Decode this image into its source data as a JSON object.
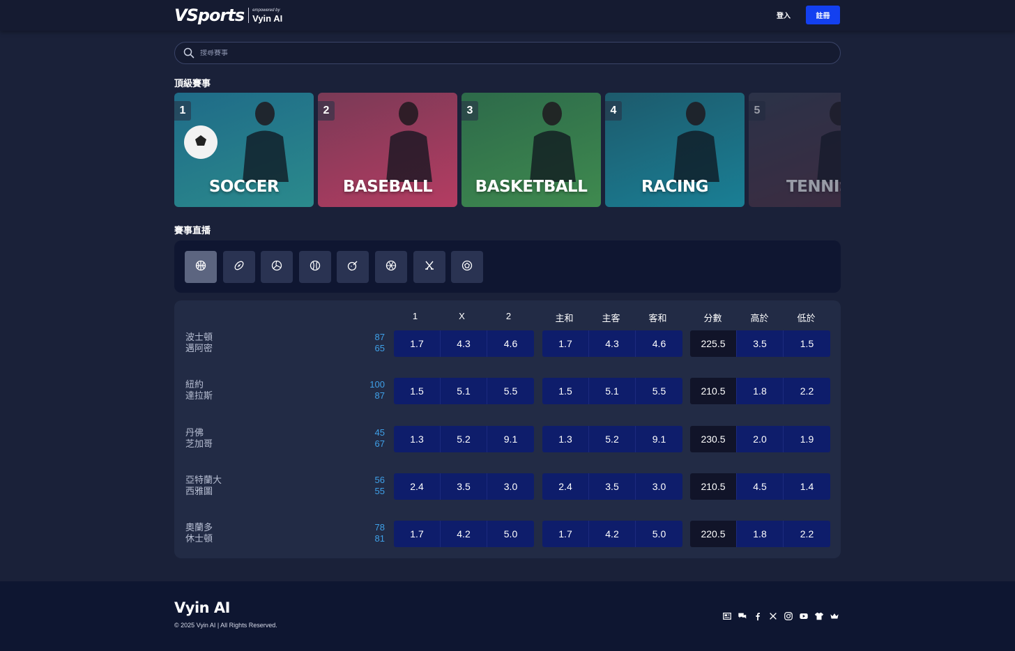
{
  "header": {
    "logo_main": "VSports",
    "logo_small": "empowered by",
    "logo_brand": "Vyin AI",
    "login_label": "登入",
    "register_label": "註冊"
  },
  "search": {
    "placeholder": "搜尋賽事"
  },
  "top_events": {
    "title": "頂級賽事",
    "cards": [
      {
        "rank": "1",
        "label": "SOCCER",
        "colors": [
          "#1f6b88",
          "#2b8a8c"
        ]
      },
      {
        "rank": "2",
        "label": "BASEBALL",
        "colors": [
          "#7a3a56",
          "#b43c62"
        ]
      },
      {
        "rank": "3",
        "label": "BASKETBALL",
        "colors": [
          "#2d6a4a",
          "#3f8a4f"
        ]
      },
      {
        "rank": "4",
        "label": "RACING",
        "colors": [
          "#1d5a6c",
          "#1a7f95"
        ]
      },
      {
        "rank": "5",
        "label": "TENNIS",
        "colors": [
          "#3a4155",
          "#5b3447"
        ]
      }
    ]
  },
  "live": {
    "title": "賽事直播",
    "sports": [
      "basketball-icon",
      "football-icon",
      "volleyball-icon",
      "baseball-icon",
      "golf-icon",
      "soccer-icon",
      "hockey-icon",
      "rugby-icon"
    ],
    "selected_index": 0
  },
  "odds_table": {
    "headers": [
      "1",
      "X",
      "2",
      "主和",
      "主客",
      "客和",
      "分數",
      "高於",
      "低於"
    ],
    "rows": [
      {
        "home": "波士頓",
        "away": "邁阿密",
        "home_score": "87",
        "away_score": "65",
        "g1": [
          "1.7",
          "4.3",
          "4.6"
        ],
        "g2": [
          "1.7",
          "4.3",
          "4.6"
        ],
        "total": "225.5",
        "over": "3.5",
        "under": "1.5"
      },
      {
        "home": "紐約",
        "away": "達拉斯",
        "home_score": "100",
        "away_score": "87",
        "g1": [
          "1.5",
          "5.1",
          "5.5"
        ],
        "g2": [
          "1.5",
          "5.1",
          "5.5"
        ],
        "total": "210.5",
        "over": "1.8",
        "under": "2.2"
      },
      {
        "home": "丹佛",
        "away": "芝加哥",
        "home_score": "45",
        "away_score": "67",
        "g1": [
          "1.3",
          "5.2",
          "9.1"
        ],
        "g2": [
          "1.3",
          "5.2",
          "9.1"
        ],
        "total": "230.5",
        "over": "2.0",
        "under": "1.9"
      },
      {
        "home": "亞特蘭大",
        "away": "西雅圖",
        "home_score": "56",
        "away_score": "55",
        "g1": [
          "2.4",
          "3.5",
          "3.0"
        ],
        "g2": [
          "2.4",
          "3.5",
          "3.0"
        ],
        "total": "210.5",
        "over": "4.5",
        "under": "1.4"
      },
      {
        "home": "奧蘭多",
        "away": "休士頓",
        "home_score": "78",
        "away_score": "81",
        "g1": [
          "1.7",
          "4.2",
          "5.0"
        ],
        "g2": [
          "1.7",
          "4.2",
          "5.0"
        ],
        "total": "220.5",
        "over": "1.8",
        "under": "2.2"
      }
    ]
  },
  "footer": {
    "logo": "Vyin AI",
    "copyright": "© 2025 Vyin AI | All Rights Reserved.",
    "socials": [
      "news-icon",
      "chat-icon",
      "facebook-icon",
      "x-icon",
      "instagram-icon",
      "youtube-icon",
      "shirt-icon",
      "crown-icon"
    ]
  }
}
